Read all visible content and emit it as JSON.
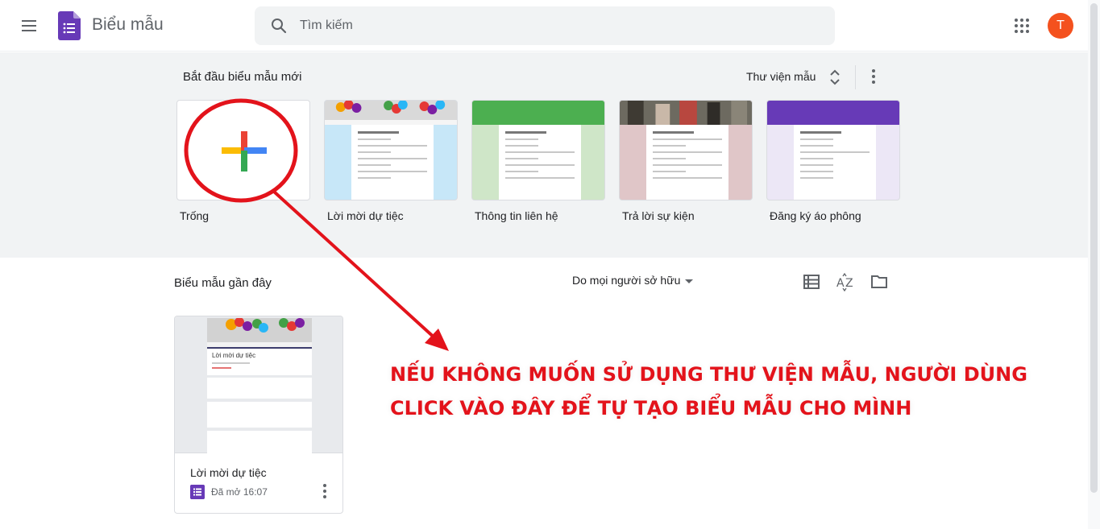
{
  "header": {
    "app_title": "Biểu mẫu",
    "search_placeholder": "Tìm kiếm",
    "avatar_initial": "T",
    "icons": {
      "menu": "hamburger-icon",
      "logo": "forms-logo-icon",
      "search": "search-icon",
      "apps": "apps-grid-icon"
    }
  },
  "gallery": {
    "title": "Bắt đầu biểu mẫu mới",
    "library_label": "Thư viện mẫu",
    "templates": [
      {
        "label": "Trống",
        "theme": "#ffffff"
      },
      {
        "label": "Lời mời dự tiệc",
        "theme": "#c7e7f8"
      },
      {
        "label": "Thông tin liên hệ",
        "theme": "#cfe6c8"
      },
      {
        "label": "Trả lời sự kiện",
        "theme": "#e0c6c8"
      },
      {
        "label": "Đăng ký áo phông",
        "theme": "#ece7f6"
      }
    ]
  },
  "recent": {
    "title": "Biểu mẫu gần đây",
    "owner_filter": "Do mọi người sở hữu",
    "view_icons": [
      "list-view-icon",
      "sort-az-icon",
      "folder-icon"
    ],
    "documents": [
      {
        "name": "Lời mời dự tiệc",
        "opened": "Đã mở 16:07",
        "thumb_title": "Lời mời dự tiệc"
      }
    ]
  },
  "annotation": {
    "line1": "NẾU KHÔNG MUỐN SỬ DỤNG THƯ VIỆN MẪU, NGƯỜI DÙNG",
    "line2": "CLICK VÀO ĐÂY ĐỂ TỰ TẠO BIỂU MẪU CHO MÌNH",
    "color": "#e3131b"
  },
  "colors": {
    "brand_purple": "#673ab7",
    "avatar_orange": "#f4511e",
    "gallery_bg": "#f1f3f4"
  }
}
